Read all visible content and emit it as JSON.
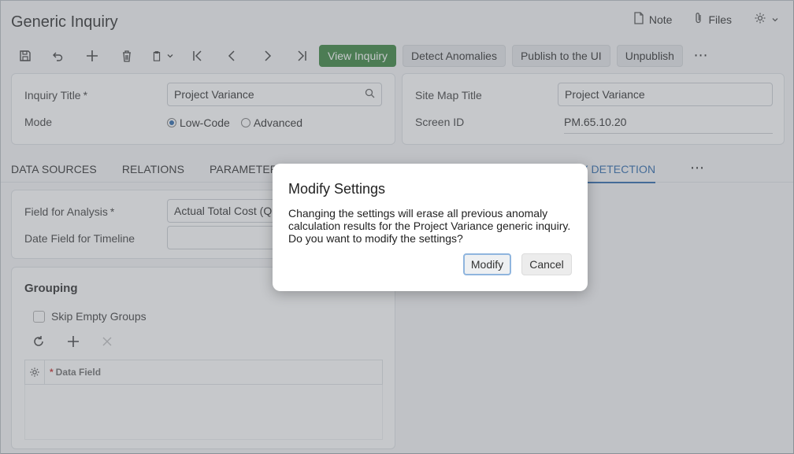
{
  "header": {
    "title": "Generic Inquiry",
    "note_label": "Note",
    "files_label": "Files"
  },
  "toolbar": {
    "view_inquiry": "View Inquiry",
    "detect_anomalies": "Detect Anomalies",
    "publish": "Publish to the UI",
    "unpublish": "Unpublish",
    "more": "⋯"
  },
  "summary_left": {
    "title_label": "Inquiry Title",
    "title_value": "Project Variance",
    "mode_label": "Mode",
    "mode_options": [
      "Low-Code",
      "Advanced"
    ],
    "mode_selected": "Low-Code"
  },
  "summary_right": {
    "sitemap_label": "Site Map Title",
    "sitemap_value": "Project Variance",
    "screen_label": "Screen ID",
    "screen_value": "PM.65.10.20"
  },
  "tabs": [
    "DATA SOURCES",
    "RELATIONS",
    "PARAMETERS",
    "ALY DETECTION"
  ],
  "tabs_more": "⋯",
  "analysis": {
    "field_label": "Field for Analysis",
    "field_value": "Actual Total Cost (QU",
    "date_label": "Date Field for Timeline",
    "date_value": ""
  },
  "grouping": {
    "heading": "Grouping",
    "skip_label": "Skip Empty Groups",
    "column_header": "Data Field",
    "required_mark": "*"
  },
  "dialog": {
    "title": "Modify Settings",
    "message": "Changing the settings will erase all previous anomaly calculation results for the Project Variance generic inquiry. Do you want to modify the settings?",
    "modify_label": "Modify",
    "cancel_label": "Cancel"
  },
  "colors": {
    "accent": "#1f5fa5",
    "primary_button": "#2e7d32"
  }
}
